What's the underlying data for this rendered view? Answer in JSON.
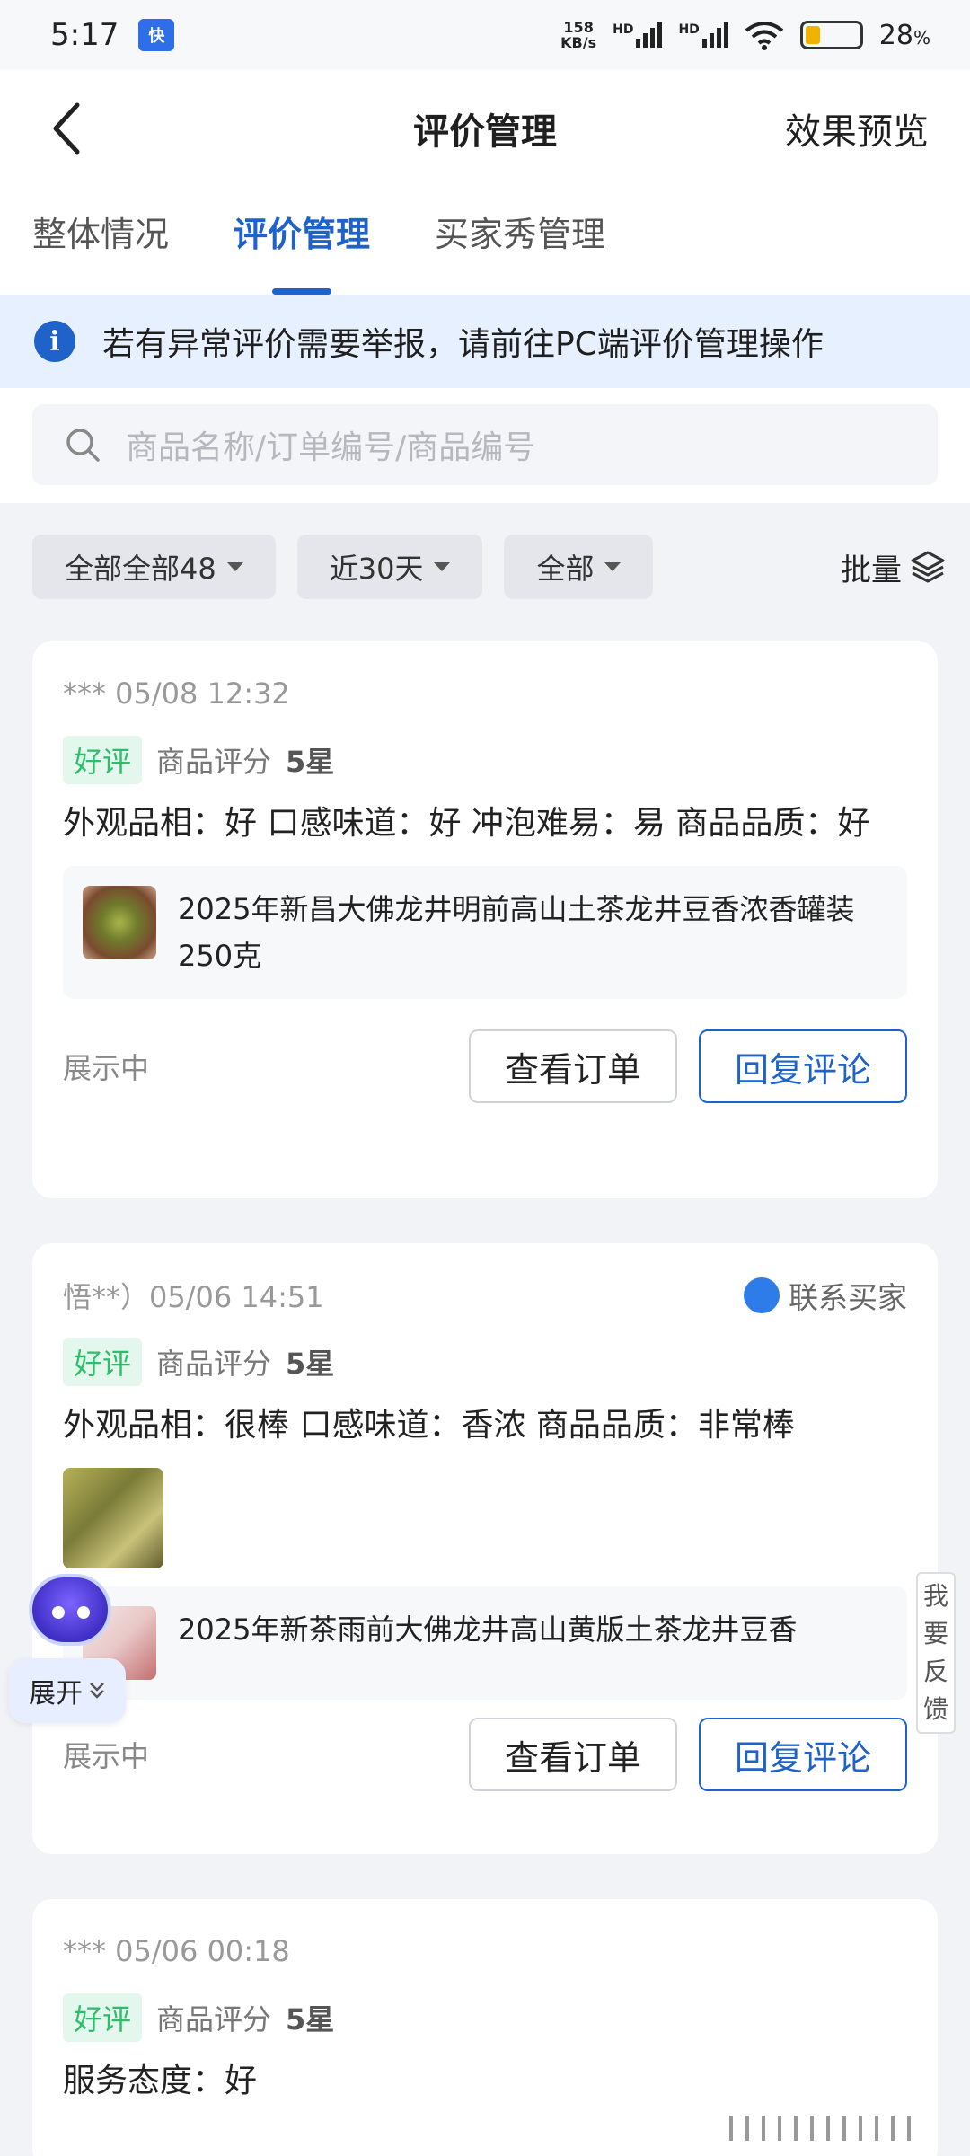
{
  "status": {
    "time": "5:17",
    "app_badge": "快",
    "speed_value": "158",
    "speed_unit": "KB/s",
    "network_1": "HD",
    "network_2": "HD",
    "battery_percent": "28",
    "battery_suffix": "%",
    "battery_level": 0.28
  },
  "navbar": {
    "title": "评价管理",
    "right_action": "效果预览"
  },
  "tabs": [
    {
      "label": "整体情况",
      "active": false
    },
    {
      "label": "评价管理",
      "active": true
    },
    {
      "label": "买家秀管理",
      "active": false
    }
  ],
  "notice": {
    "icon": "info-icon",
    "text": "若有异常评价需要举报，请前往PC端评价管理操作"
  },
  "search": {
    "placeholder": "商品名称/订单编号/商品编号"
  },
  "filters": {
    "chip_1": "全部全部48",
    "chip_2": "近30天",
    "chip_3": "全部",
    "batch": "批量"
  },
  "reviews": [
    {
      "reviewer": "*** 05/08 12:32",
      "tag": "好评",
      "rating_label": "商品评分",
      "rating_value": "5星",
      "text": "外观品相：好 口感味道：好 冲泡难易：易 商品品质：好",
      "product": "2025年新昌大佛龙井明前高山土茶龙井豆香浓香罐装250克",
      "status": "展示中",
      "btn_order": "查看订单",
      "btn_reply": "回复评论"
    },
    {
      "reviewer": "悟**）05/06 14:51",
      "contact": "联系买家",
      "tag": "好评",
      "rating_label": "商品评分",
      "rating_value": "5星",
      "text": "外观品相：很棒 口感味道：香浓 商品品质：非常棒",
      "product": "2025年新茶雨前大佛龙井高山黄版土茶龙井豆香",
      "status": "展示中",
      "btn_order": "查看订单",
      "btn_reply": "回复评论"
    },
    {
      "reviewer": "*** 05/06 00:18",
      "tag": "好评",
      "rating_label": "商品评分",
      "rating_value": "5星",
      "text": "服务态度：好"
    }
  ],
  "floating": {
    "expand": "展开",
    "expand_icon": "chevron-double-down-icon",
    "feedback": [
      "我",
      "要",
      "反",
      "馈"
    ]
  },
  "colors": {
    "accent": "#1f62c9",
    "good_tag": "#2ebd6a",
    "notice_bg": "#e7f0ff"
  }
}
